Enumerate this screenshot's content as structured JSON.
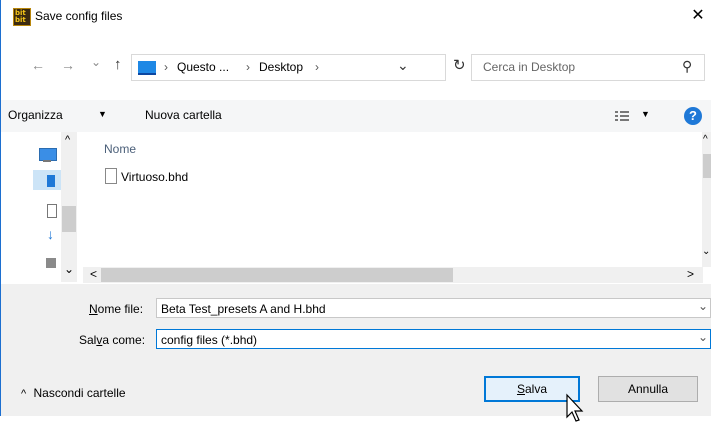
{
  "window": {
    "title": "Save config files",
    "app_icon": "bit-app-icon",
    "close_glyph": "✕"
  },
  "nav": {
    "back": "←",
    "forward": "→",
    "recent": "⌄",
    "up": "↑",
    "breadcrumb": [
      "Questo ...",
      "Desktop"
    ],
    "sep": "›",
    "dropdown": "⌄",
    "refresh": "↻",
    "search_placeholder": "Cerca in Desktop",
    "search_glyph": "⚲"
  },
  "toolbar": {
    "organize": "Organizza",
    "organize_arrow": "▼",
    "new_folder": "Nuova cartella",
    "view_arrow": "▼",
    "help": "?"
  },
  "files": {
    "column_header": "Nome",
    "items": [
      {
        "name": "Virtuoso.bhd"
      }
    ]
  },
  "scroll": {
    "left": "<",
    "right": ">",
    "up": "^",
    "down": "⌄"
  },
  "form": {
    "filename_label_pre": "",
    "filename_label_u": "N",
    "filename_label_post": "ome file:",
    "filename_value": "Beta Test_presets A and H.bhd",
    "type_label_pre": "Sal",
    "type_label_u": "v",
    "type_label_post": "a come:",
    "type_value": "config files (*.bhd)",
    "chevron": "⌄"
  },
  "footer": {
    "hide_folders": "Nascondi cartelle",
    "hide_caret": "^",
    "save_u": "S",
    "save_rest": "alva",
    "cancel": "Annulla"
  },
  "colors": {
    "accent": "#0078d7",
    "border": "#1c6fd0",
    "help": "#1e78d7"
  }
}
